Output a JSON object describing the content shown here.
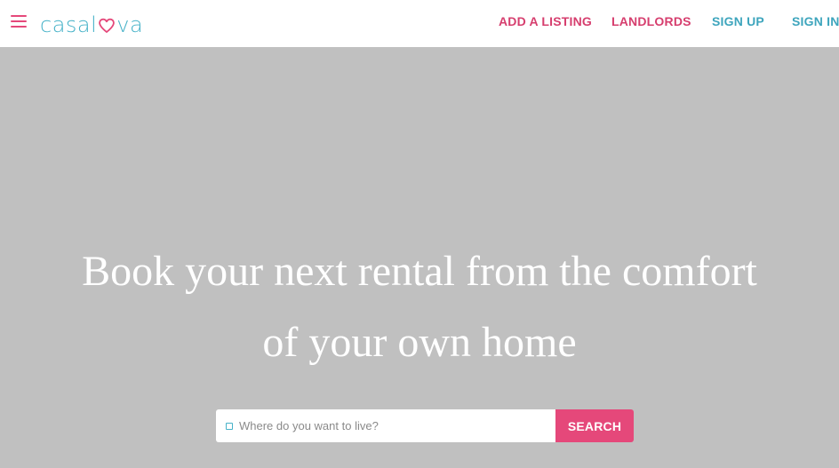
{
  "nav": {
    "menu_icon": "hamburger-menu-icon",
    "logo": {
      "text_before": "casal",
      "heart_icon": "heart-icon",
      "text_after": "va"
    },
    "links": [
      {
        "label": "ADD A LISTING",
        "color": "#d63e6e"
      },
      {
        "label": "LANDLORDS",
        "color": "#d63e6e"
      },
      {
        "label": "SIGN UP",
        "color": "#3ea5bd"
      },
      {
        "label": "SIGN IN",
        "color": "#3ea5bd"
      }
    ]
  },
  "hero": {
    "title_line1": "Book your next rental from the comfort",
    "title_line2": "of your own home"
  },
  "search": {
    "placeholder": "Where do you want to live?",
    "value": "",
    "button_label": "SEARCH"
  },
  "colors": {
    "brand_pink": "#e5487a",
    "brand_teal": "#46b2c8",
    "hero_background": "#c0c0c0"
  }
}
